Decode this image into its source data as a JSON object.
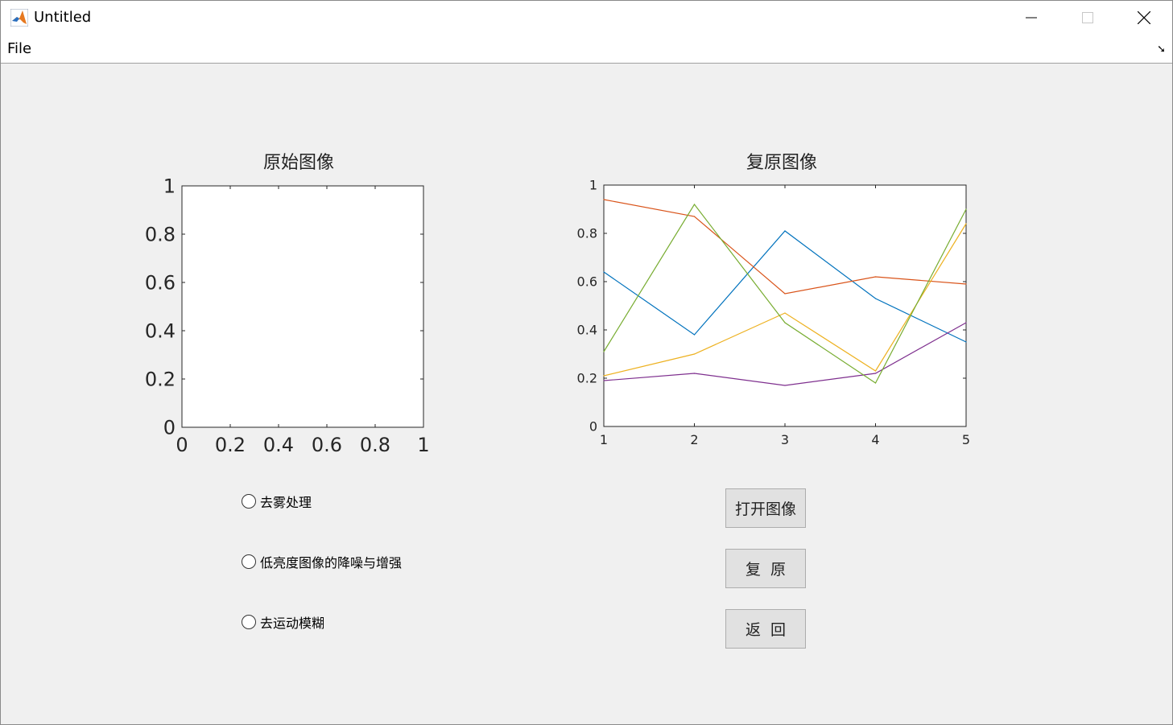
{
  "window": {
    "title": "Untitled"
  },
  "menubar": {
    "file_label": "File"
  },
  "left_axes": {
    "title": "原始图像"
  },
  "right_axes": {
    "title": "复原图像"
  },
  "radios": [
    {
      "label": "去雾处理",
      "selected": false
    },
    {
      "label": "低亮度图像的降噪与增强",
      "selected": false
    },
    {
      "label": "去运动模糊",
      "selected": false
    }
  ],
  "buttons": {
    "open": "打开图像",
    "restore": "复  原",
    "back": "返  回"
  },
  "chart_data": [
    {
      "type": "line",
      "title": "原始图像",
      "x": [],
      "series": [],
      "xlim": [
        0,
        1
      ],
      "ylim": [
        0,
        1
      ],
      "xticks": [
        "0",
        "0.2",
        "0.4",
        "0.6",
        "0.8",
        "1"
      ],
      "yticks": [
        "0",
        "0.2",
        "0.4",
        "0.6",
        "0.8",
        "1"
      ],
      "grid": false
    },
    {
      "type": "line",
      "title": "复原图像",
      "x": [
        1,
        2,
        3,
        4,
        5
      ],
      "xlim": [
        1,
        5
      ],
      "ylim": [
        0,
        1
      ],
      "xticks": [
        "1",
        "2",
        "3",
        "4",
        "5"
      ],
      "yticks": [
        "0",
        "0.2",
        "0.4",
        "0.6",
        "0.8",
        "1"
      ],
      "grid": false,
      "series": [
        {
          "color": "#0072bd",
          "values": [
            0.64,
            0.38,
            0.81,
            0.53,
            0.35
          ]
        },
        {
          "color": "#d95319",
          "values": [
            0.94,
            0.87,
            0.55,
            0.62,
            0.59
          ]
        },
        {
          "color": "#edb120",
          "values": [
            0.21,
            0.3,
            0.47,
            0.23,
            0.84
          ]
        },
        {
          "color": "#7e2f8e",
          "values": [
            0.19,
            0.22,
            0.17,
            0.22,
            0.43
          ]
        },
        {
          "color": "#77ac30",
          "values": [
            0.31,
            0.92,
            0.43,
            0.18,
            0.9
          ]
        }
      ]
    }
  ]
}
